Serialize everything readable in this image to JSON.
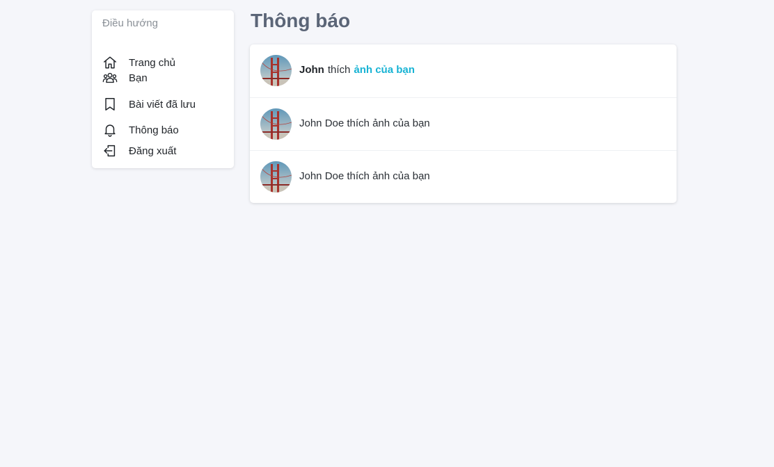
{
  "sidebar": {
    "heading": "Điều hướng",
    "items": [
      {
        "label": "Trang chủ",
        "icon": "home-icon"
      },
      {
        "label": "Bạn",
        "icon": "friends-icon"
      },
      {
        "label": "Bài viết đã lưu",
        "icon": "bookmark-icon"
      },
      {
        "label": "Thông báo",
        "icon": "bell-icon"
      },
      {
        "label": "Đăng xuất",
        "icon": "logout-icon"
      }
    ]
  },
  "main": {
    "title": "Thông báo",
    "notifications": [
      {
        "actor": "John",
        "verb": "thích",
        "target": "ảnh của bạn",
        "avatar": "golden-gate-bridge-avatar"
      },
      {
        "text": "John Doe thích ảnh của bạn",
        "avatar": "golden-gate-bridge-avatar"
      },
      {
        "text": "John Doe thích ảnh của bạn",
        "avatar": "golden-gate-bridge-avatar"
      }
    ]
  },
  "colors": {
    "background": "#f5f6fa",
    "title": "#5b6577",
    "link": "#17b3d4",
    "muted": "#8a9097"
  }
}
